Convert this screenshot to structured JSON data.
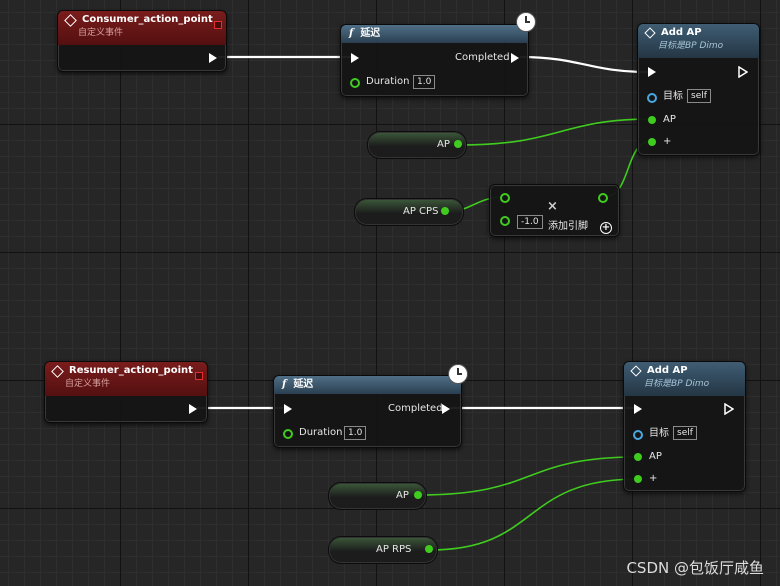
{
  "nodes": {
    "consumer_event": {
      "title": "Consumer_action_point",
      "subtitle": "自定义事件"
    },
    "delay1": {
      "title": "延迟",
      "completed": "Completed",
      "duration_label": "Duration",
      "duration_value": "1.0"
    },
    "addap1": {
      "title": "Add AP",
      "subtitle": "目标是BP Dimo",
      "target_label": "目标",
      "target_value": "self",
      "ap_label": "AP",
      "plus_label": "+"
    },
    "ap_var1": {
      "label": "AP"
    },
    "apcps_var": {
      "label": "AP CPS"
    },
    "multiply": {
      "input_value": "-1.0",
      "add_pin_label": "添加引脚"
    },
    "resumer_event": {
      "title": "Resumer_action_point",
      "subtitle": "自定义事件"
    },
    "delay2": {
      "title": "延迟",
      "completed": "Completed",
      "duration_label": "Duration",
      "duration_value": "1.0"
    },
    "addap2": {
      "title": "Add AP",
      "subtitle": "目标是BP Dimo",
      "target_label": "目标",
      "target_value": "self",
      "ap_label": "AP",
      "plus_label": "+"
    },
    "ap_var2": {
      "label": "AP"
    },
    "aprps_var": {
      "label": "AP RPS"
    }
  },
  "icons": [
    "event-diamond-icon",
    "function-icon",
    "clock-icon",
    "exec-pin-icon",
    "data-pin-icon",
    "close-icon",
    "add-pin-icon"
  ],
  "colors": {
    "float_pin": "#3fcc1f",
    "object_pin": "#49a7e0",
    "event_header": "#7a1c1c",
    "function_header": "#3f5d73",
    "exec_wire": "#ffffff"
  },
  "watermark": "CSDN @包饭厅咸鱼"
}
